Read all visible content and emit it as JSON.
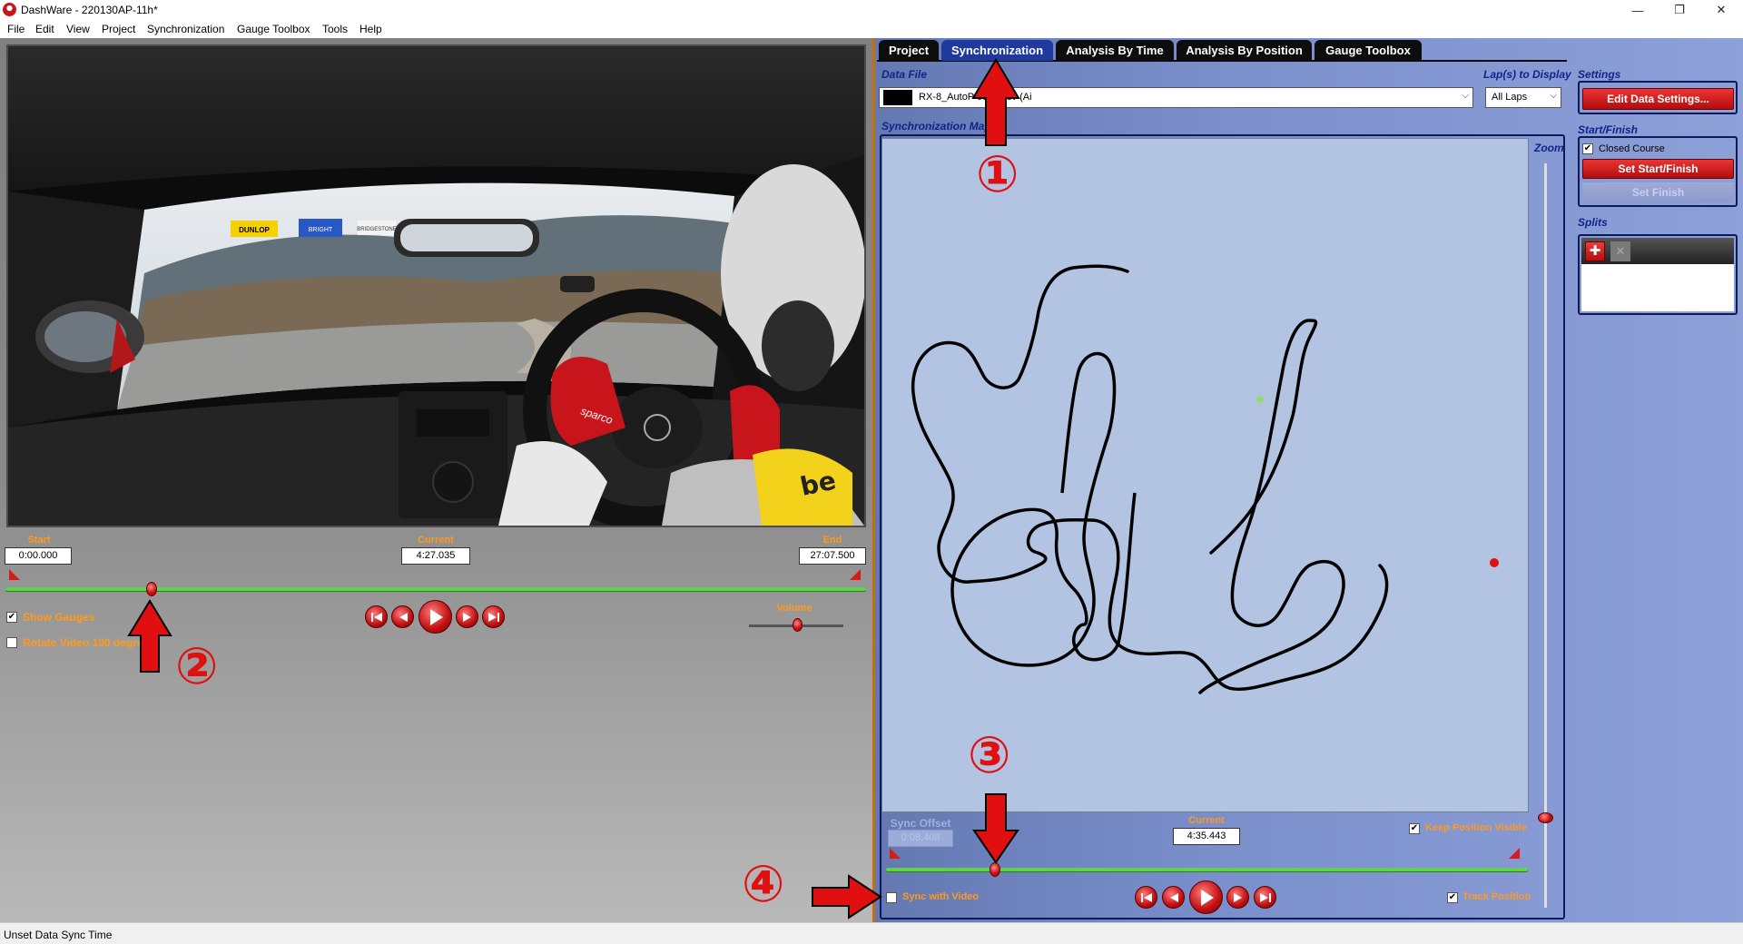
{
  "window": {
    "title": "DashWare - 220130AP-11h*",
    "minimize": "—",
    "restore": "❐",
    "close": "✕"
  },
  "menu": [
    "File",
    "Edit",
    "View",
    "Project",
    "Synchronization",
    "Gauge Toolbox",
    "Tools",
    "Help"
  ],
  "video": {
    "banners": [
      "DUNLOP",
      "BRIGHT",
      "BRIDGESTONE"
    ],
    "glove_brand": "sparco",
    "start_label": "Start",
    "start_value": "0:00.000",
    "current_label": "Current",
    "current_value": "4:27.035",
    "end_label": "End",
    "end_value": "27:07.500",
    "slider_position": 0.17,
    "show_gauges_label": "Show Gauges",
    "show_gauges_checked": true,
    "rotate_label": "Rotate Video 180 degre",
    "rotate_checked": false,
    "volume_label": "Volume",
    "volume_level": 0.51
  },
  "tabs": [
    {
      "label": "Project",
      "active": false
    },
    {
      "label": "Synchronization",
      "active": true
    },
    {
      "label": "Analysis By Time",
      "active": false
    },
    {
      "label": "Analysis By Position",
      "active": false
    },
    {
      "label": "Gauge Toolbox",
      "active": false
    }
  ],
  "sync": {
    "data_file_label": "Data File",
    "data_file_value": "RX-8_AutoP                0337.csv (AiM)",
    "laps_label": "Lap(s) to Display",
    "laps_value": "All Laps",
    "map_label": "Synchronization Map",
    "zoom_label": "Zoom",
    "zoom_level": 0.13,
    "sync_offset_label": "Sync Offset",
    "sync_offset_value": "0:08.408",
    "current_label": "Current",
    "current_value": "4:35.443",
    "slider_position": 0.17,
    "keep_position_label": "Keep Position Visible",
    "keep_position_checked": true,
    "sync_video_label": "Sync with Video",
    "sync_video_checked": false,
    "track_position_label": "Track Position",
    "track_position_checked": true
  },
  "settings": {
    "settings_label": "Settings",
    "edit_button": "Edit Data Settings...",
    "start_finish_label": "Start/Finish",
    "closed_course_label": "Closed Course",
    "closed_course_checked": true,
    "set_start_finish": "Set Start/Finish",
    "set_finish": "Set Finish",
    "splits_label": "Splits",
    "add_glyph": "✚",
    "remove_glyph": "✕"
  },
  "annotations": [
    "①",
    "②",
    "③",
    "④"
  ],
  "status": {
    "text": "Unset Data Sync Time"
  },
  "colors": {
    "accent_orange": "#ff9a1c",
    "active_tab": "#1f3a9c",
    "button_red": "#d01818",
    "slider_green": "#5fd34a",
    "annotation_red": "#e10f0f"
  }
}
